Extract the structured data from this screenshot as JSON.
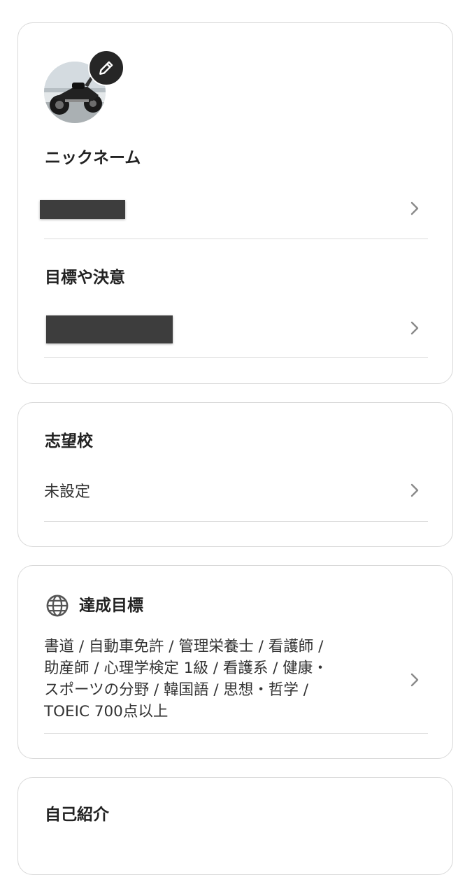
{
  "profile": {
    "nickname_label": "ニックネーム",
    "goal_label": "目標や決意"
  },
  "school": {
    "label": "志望校",
    "value": "未設定"
  },
  "achievement": {
    "label": "達成目標",
    "icon": "globe-icon",
    "lines": [
      "書道 / 自動車免許 / 管理栄養士 / 看護師 /",
      "助産師 / 心理学検定 1級 / 看護系 / 健康・",
      "スポーツの分野 / 韓国語 / 思想・哲学 /",
      "TOEIC 700点以上"
    ]
  },
  "intro": {
    "label": "自己紹介"
  },
  "colors": {
    "card_border": "#d9d9d9",
    "divider": "#dcdcdc",
    "chevron": "#8a8a8a",
    "redaction": "#3d3d3d",
    "edit_badge": "#262626"
  }
}
